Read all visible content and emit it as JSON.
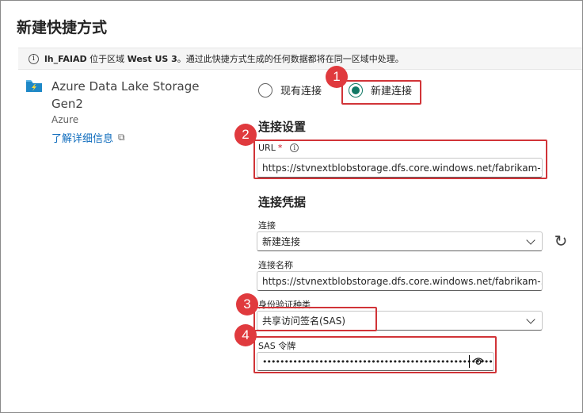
{
  "page": {
    "title": "新建快捷方式"
  },
  "info_bar": {
    "lakehouse": "lh_FAIAD",
    "text_before": " 位于区域 ",
    "region": "West US 3",
    "text_after": "。通过此快捷方式生成的任何数据都将在同一区域中处理。"
  },
  "source": {
    "name": "Azure Data Lake Storage Gen2",
    "type": "Azure",
    "learn_more": "了解详细信息",
    "icon": "azure-data-lake-storage-icon"
  },
  "connection_choice": {
    "existing_label": "现有连接",
    "new_label": "新建连接",
    "selected": "new"
  },
  "connection_settings": {
    "heading": "连接设置",
    "url_label": "URL",
    "url_required": "*",
    "url_value": "https://stvnextblobstorage.dfs.core.windows.net/fabrikam-..."
  },
  "credentials": {
    "heading": "连接凭据",
    "connection_label": "连接",
    "connection_value": "新建连接",
    "connection_name_label": "连接名称",
    "connection_name_value": "https://stvnextblobstorage.dfs.core.windows.net/fabrikam-...",
    "auth_kind_label": "身份验证种类",
    "auth_kind_value": "共享访问签名(SAS)",
    "sas_label": "SAS 令牌",
    "sas_value": "•••••••••••••••••••••••••••••••••••••••••••••••••••••••••••••••••••"
  },
  "badges": [
    "1",
    "2",
    "3",
    "4"
  ],
  "colors": {
    "accent": "#117865",
    "link": "#0f6cbd",
    "annotation": "#d13438",
    "badge": "#e03a3e"
  }
}
